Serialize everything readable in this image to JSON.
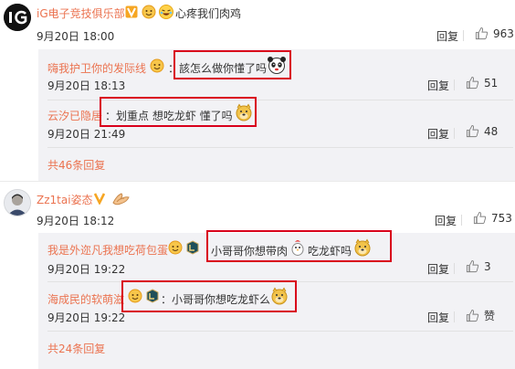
{
  "threads": [
    {
      "user": "iG电子竞技俱乐部",
      "text": "心疼我们肉鸡",
      "time": "9月20日 18:00",
      "reply_label": "回复",
      "likes": "963",
      "replies": [
        {
          "user": "嗨我护卫你的发际线",
          "text": "：該怎么做你懂了吗",
          "time": "9月20日 18:13",
          "reply_label": "回复",
          "likes": "51"
        },
        {
          "user": "云汐已隐居",
          "text": "：划重点 想吃龙虾 懂了吗",
          "time": "9月20日 21:49",
          "reply_label": "回复",
          "likes": "48"
        }
      ],
      "more": "共46条回复"
    },
    {
      "user": "Zz1tai姿态",
      "time": "9月20日 18:12",
      "reply_label": "回复",
      "likes": "753",
      "replies": [
        {
          "user": "我是外迩凡我想吃荷包蛋",
          "text": "小哥哥你想带肉",
          "text2": "吃龙虾吗",
          "time": "9月20日 19:22",
          "reply_label": "回复",
          "likes": "3"
        },
        {
          "user": "海成民的软萌滋",
          "text": "：小哥哥你想吃龙虾么",
          "time": "9月20日 19:22",
          "reply_label": "回复",
          "likes": "赞"
        }
      ],
      "more": "共24条回复"
    }
  ],
  "colors": {
    "username": "#eb7350",
    "highlight_box": "#d9001b",
    "subreply_bg": "#f2f2f5",
    "text": "#333333"
  },
  "icons": [
    "ig-logo-avatar",
    "vip-badge",
    "level-badge",
    "crying-laugh-emoji",
    "panda-emoji",
    "doge-emoji",
    "chicken-emoji",
    "clap-emoji",
    "thumbs-up-icon"
  ]
}
